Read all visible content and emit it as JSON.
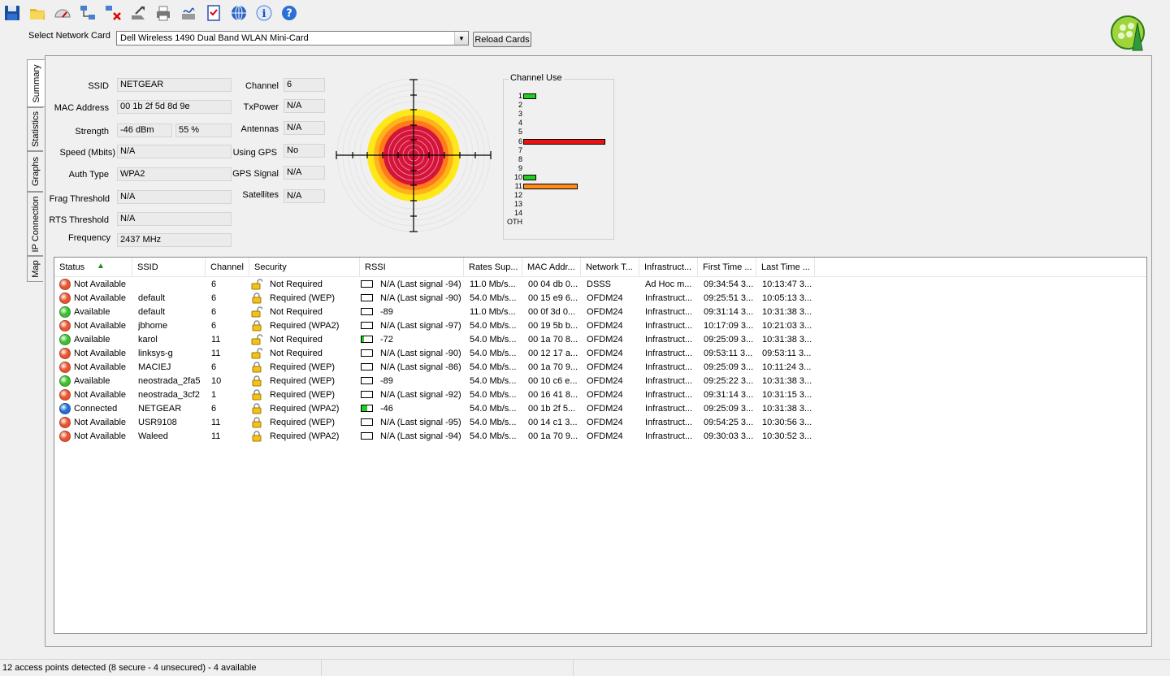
{
  "toolbar": {
    "icons": [
      "save-icon",
      "open-folder-icon",
      "speedometer-icon",
      "network-connect-icon",
      "network-disconnect-icon",
      "export-icon",
      "print-icon",
      "signature-icon",
      "checklist-icon",
      "globe-icon",
      "info-icon",
      "help-icon"
    ]
  },
  "card": {
    "label": "Select Network Card",
    "selected": "Dell Wireless 1490 Dual Band WLAN Mini-Card",
    "reload_label": "Reload Cards"
  },
  "tabs": [
    "Summary",
    "Statistics",
    "Graphs",
    "IP Connection",
    "Map"
  ],
  "summary": {
    "ssid_label": "SSID",
    "ssid": "NETGEAR",
    "mac_label": "MAC Address",
    "mac": "00 1b 2f 5d 8d 9e",
    "strength_label": "Strength",
    "strength_dbm": "-46 dBm",
    "strength_pct": "55 %",
    "speed_label": "Speed (Mbits)",
    "speed": "N/A",
    "auth_label": "Auth Type",
    "auth": "WPA2",
    "frag_label": "Frag Threshold",
    "frag": "N/A",
    "rts_label": "RTS Threshold",
    "rts": "N/A",
    "freq_label": "Frequency",
    "freq": "2437 MHz",
    "channel_label": "Channel",
    "channel": "6",
    "txpower_label": "TxPower",
    "txpower": "N/A",
    "antennas_label": "Antennas",
    "antennas": "N/A",
    "gps_label": "Using GPS",
    "gps": "No",
    "gpssig_label": "GPS Signal",
    "gpssig": "N/A",
    "sat_label": "Satellites",
    "sat": "N/A"
  },
  "channel_use": {
    "title": "Channel Use",
    "channels": [
      "1",
      "2",
      "3",
      "4",
      "5",
      "6",
      "7",
      "8",
      "9",
      "10",
      "11",
      "12",
      "13",
      "14",
      "OTH"
    ],
    "usage": [
      {
        "channel": "1",
        "level": 0.16,
        "color": "#22cc22"
      },
      {
        "channel": "6",
        "level": 1.0,
        "color": "#ee1111"
      },
      {
        "channel": "10",
        "level": 0.16,
        "color": "#22cc22"
      },
      {
        "channel": "11",
        "level": 0.66,
        "color": "#ff8c1a"
      }
    ]
  },
  "list": {
    "columns": [
      "Status",
      "SSID",
      "Channel",
      "Security",
      "RSSI",
      "Rates Sup...",
      "MAC Addr...",
      "Network T...",
      "Infrastruct...",
      "First Time ...",
      "Last Time ..."
    ],
    "rows": [
      {
        "status": "Not Available",
        "dot": "red",
        "ssid": "",
        "channel": "6",
        "lock": "open",
        "security": "Not Required",
        "sig": 0,
        "rssi": "N/A (Last signal -94)",
        "rates": "11.0 Mb/s...",
        "mac": "00 04 db 0...",
        "net": "DSSS",
        "infra": "Ad Hoc m...",
        "first": "09:34:54 3...",
        "last": "10:13:47 3..."
      },
      {
        "status": "Not Available",
        "dot": "red",
        "ssid": "default",
        "channel": "6",
        "lock": "closed",
        "security": "Required (WEP)",
        "sig": 0,
        "rssi": "N/A (Last signal -90)",
        "rates": "54.0 Mb/s...",
        "mac": "00 15 e9 6...",
        "net": "OFDM24",
        "infra": "Infrastruct...",
        "first": "09:25:51 3...",
        "last": "10:05:13 3..."
      },
      {
        "status": "Available",
        "dot": "green",
        "ssid": "default",
        "channel": "6",
        "lock": "open",
        "security": "Not Required",
        "sig": 0,
        "rssi": "-89",
        "rates": "11.0 Mb/s...",
        "mac": "00 0f 3d 0...",
        "net": "OFDM24",
        "infra": "Infrastruct...",
        "first": "09:31:14 3...",
        "last": "10:31:38 3..."
      },
      {
        "status": "Not Available",
        "dot": "red",
        "ssid": "jbhome",
        "channel": "6",
        "lock": "closed",
        "security": "Required (WPA2)",
        "sig": 0,
        "rssi": "N/A (Last signal -97)",
        "rates": "54.0 Mb/s...",
        "mac": "00 19 5b b...",
        "net": "OFDM24",
        "infra": "Infrastruct...",
        "first": "10:17:09 3...",
        "last": "10:21:03 3..."
      },
      {
        "status": "Available",
        "dot": "green",
        "ssid": "karol",
        "channel": "11",
        "lock": "open",
        "security": "Not Required",
        "sig": 0.25,
        "rssi": "-72",
        "rates": "54.0 Mb/s...",
        "mac": "00 1a 70 8...",
        "net": "OFDM24",
        "infra": "Infrastruct...",
        "first": "09:25:09 3...",
        "last": "10:31:38 3..."
      },
      {
        "status": "Not Available",
        "dot": "red",
        "ssid": "linksys-g",
        "channel": "11",
        "lock": "open",
        "security": "Not Required",
        "sig": 0,
        "rssi": "N/A (Last signal -90)",
        "rates": "54.0 Mb/s...",
        "mac": "00 12 17 a...",
        "net": "OFDM24",
        "infra": "Infrastruct...",
        "first": "09:53:11 3...",
        "last": "09:53:11 3..."
      },
      {
        "status": "Not Available",
        "dot": "red",
        "ssid": "MACIEJ",
        "channel": "6",
        "lock": "closed",
        "security": "Required (WEP)",
        "sig": 0,
        "rssi": "N/A (Last signal -86)",
        "rates": "54.0 Mb/s...",
        "mac": "00 1a 70 9...",
        "net": "OFDM24",
        "infra": "Infrastruct...",
        "first": "09:25:09 3...",
        "last": "10:11:24 3..."
      },
      {
        "status": "Available",
        "dot": "green",
        "ssid": "neostrada_2fa5",
        "channel": "10",
        "lock": "closed",
        "security": "Required (WEP)",
        "sig": 0,
        "rssi": "-89",
        "rates": "54.0 Mb/s...",
        "mac": "00 10 c6 e...",
        "net": "OFDM24",
        "infra": "Infrastruct...",
        "first": "09:25:22 3...",
        "last": "10:31:38 3..."
      },
      {
        "status": "Not Available",
        "dot": "red",
        "ssid": "neostrada_3cf2",
        "channel": "1",
        "lock": "closed",
        "security": "Required (WEP)",
        "sig": 0,
        "rssi": "N/A (Last signal -92)",
        "rates": "54.0 Mb/s...",
        "mac": "00 16 41 8...",
        "net": "OFDM24",
        "infra": "Infrastruct...",
        "first": "09:31:14 3...",
        "last": "10:31:15 3..."
      },
      {
        "status": "Connected",
        "dot": "blue",
        "ssid": "NETGEAR",
        "channel": "6",
        "lock": "closed",
        "security": "Required (WPA2)",
        "sig": 0.5,
        "rssi": "-46",
        "rates": "54.0 Mb/s...",
        "mac": "00 1b 2f 5...",
        "net": "OFDM24",
        "infra": "Infrastruct...",
        "first": "09:25:09 3...",
        "last": "10:31:38 3..."
      },
      {
        "status": "Not Available",
        "dot": "red",
        "ssid": "USR9108",
        "channel": "11",
        "lock": "closed",
        "security": "Required (WEP)",
        "sig": 0,
        "rssi": "N/A (Last signal -95)",
        "rates": "54.0 Mb/s...",
        "mac": "00 14 c1 3...",
        "net": "OFDM24",
        "infra": "Infrastruct...",
        "first": "09:54:25 3...",
        "last": "10:30:56 3..."
      },
      {
        "status": "Not Available",
        "dot": "red",
        "ssid": "Waleed",
        "channel": "11",
        "lock": "closed",
        "security": "Required (WPA2)",
        "sig": 0,
        "rssi": "N/A (Last signal -94)",
        "rates": "54.0 Mb/s...",
        "mac": "00 1a 70 9...",
        "net": "OFDM24",
        "infra": "Infrastruct...",
        "first": "09:30:03 3...",
        "last": "10:30:52 3..."
      }
    ]
  },
  "status_bar": {
    "text": "12 access points detected (8 secure - 4 unsecured) - 4 available"
  },
  "colors": {
    "dot_red": "#e8542e",
    "dot_green": "#3cbf2c",
    "dot_blue": "#1e6fd6",
    "lock": "#f2c21a"
  }
}
